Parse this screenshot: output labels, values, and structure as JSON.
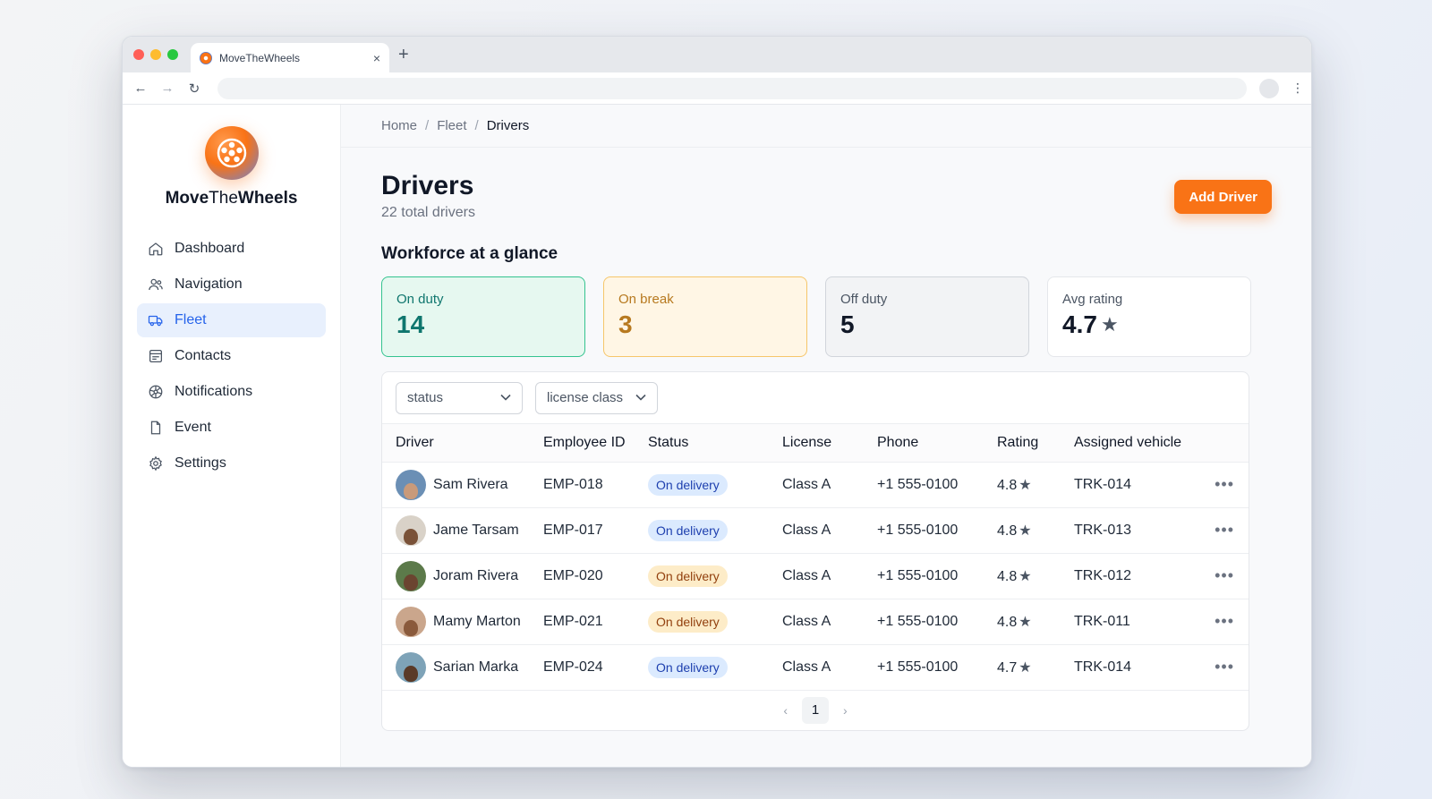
{
  "browser": {
    "tab_title": "MoveTheWheels",
    "tab_close": "×",
    "new_tab": "+",
    "back": "←",
    "forward": "→",
    "reload": "↻",
    "menu": "⋮"
  },
  "brand": {
    "part1": "Move",
    "part2": "The",
    "part3": "Wheels",
    "logo_icon": "wheel-icon"
  },
  "sidebar": {
    "items": [
      {
        "label": "Dashboard",
        "icon": "home-icon",
        "active": false
      },
      {
        "label": "Navigation",
        "icon": "users-icon",
        "active": false
      },
      {
        "label": "Fleet",
        "icon": "truck-icon",
        "active": true
      },
      {
        "label": "Contacts",
        "icon": "contacts-card-icon",
        "active": false
      },
      {
        "label": "Notifications",
        "icon": "globe-icon",
        "active": false
      },
      {
        "label": "Event",
        "icon": "document-icon",
        "active": false
      },
      {
        "label": "Settings",
        "icon": "gear-icon",
        "active": false
      }
    ],
    "active_color": "#2563eb"
  },
  "breadcrumb": {
    "home": "Home",
    "fleet": "Fleet",
    "current": "Drivers",
    "separator": "/"
  },
  "header": {
    "title": "Drivers",
    "subtitle": "22 total drivers",
    "add_button": "Add Driver",
    "accent": "#f97316"
  },
  "workforce": {
    "title": "Workforce at a glance",
    "cards": [
      {
        "label": "On duty",
        "value": "14"
      },
      {
        "label": "On break",
        "value": "3"
      },
      {
        "label": "Off duty",
        "value": "5"
      },
      {
        "label": "Avg rating",
        "value": "4.7",
        "star": "★"
      }
    ]
  },
  "filters": {
    "status": "status",
    "license": "license class",
    "chevron": "⌄"
  },
  "table": {
    "columns": [
      "Driver",
      "Employee ID",
      "Status",
      "License",
      "Phone",
      "Rating",
      "Assigned vehicle"
    ],
    "rows": [
      {
        "driver": "Sam Rivera",
        "emp": "EMP-018",
        "status": "On delivery",
        "tone": "blue",
        "license": "Class A",
        "phone": "+1 555-0100",
        "rating": "4.8",
        "vehicle": "TRK-014",
        "more": "•••"
      },
      {
        "driver": "Jame Tarsam",
        "emp": "EMP-017",
        "status": "On delivery",
        "tone": "blue",
        "license": "Class A",
        "phone": "+1 555-0100",
        "rating": "4.8",
        "vehicle": "TRK-013",
        "more": "•••"
      },
      {
        "driver": "Joram Rivera",
        "emp": "EMP-020",
        "status": "On delivery",
        "tone": "amber",
        "license": "Class A",
        "phone": "+1 555-0100",
        "rating": "4.8",
        "vehicle": "TRK-012",
        "more": "•••"
      },
      {
        "driver": "Mamy Marton",
        "emp": "EMP-021",
        "status": "On delivery",
        "tone": "amber",
        "license": "Class A",
        "phone": "+1 555-0100",
        "rating": "4.8",
        "vehicle": "TRK-011",
        "more": "•••"
      },
      {
        "driver": "Sarian Marka",
        "emp": "EMP-024",
        "status": "On delivery",
        "tone": "blue",
        "license": "Class A",
        "phone": "+1 555-0100",
        "rating": "4.7",
        "vehicle": "TRK-014",
        "more": "•••"
      }
    ],
    "star": "★"
  },
  "pagination": {
    "prev": "‹",
    "page": "1",
    "next": "›"
  }
}
